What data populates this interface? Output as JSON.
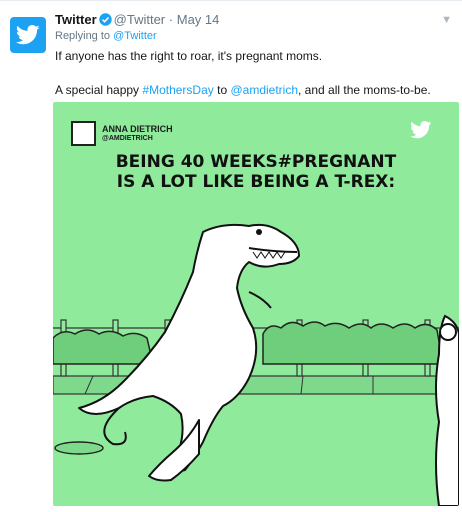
{
  "tweet": {
    "author_name": "Twitter",
    "handle": "@Twitter",
    "separator": "·",
    "date": "May 14",
    "replying_prefix": "Replying to",
    "replying_handle": "@Twitter",
    "text_line1": "If anyone has the right to roar, it's pregnant moms.",
    "text_line2_prefix": "A special happy ",
    "text_line2_hashtag": "#MothersDay",
    "text_line2_mid": " to ",
    "text_line2_mention": "@amdietrich",
    "text_line2_suffix": ", and all the moms-to-be."
  },
  "media": {
    "credit_name": "ANNA DIETRICH",
    "credit_handle": "@AMDIETRICH",
    "caption_line1": "BEING 40 WEEKS#PREGNANT",
    "caption_line2": "IS A LOT LIKE BEING A T-REX:"
  },
  "colors": {
    "accent": "#1da1f2",
    "media_background": "#8fea9c",
    "secondary_text": "#657786"
  },
  "icons": {
    "avatar": "twitter-bird-icon",
    "verified": "verified-badge-icon",
    "menu": "chevron-down-icon",
    "watermark": "twitter-bird-icon"
  }
}
